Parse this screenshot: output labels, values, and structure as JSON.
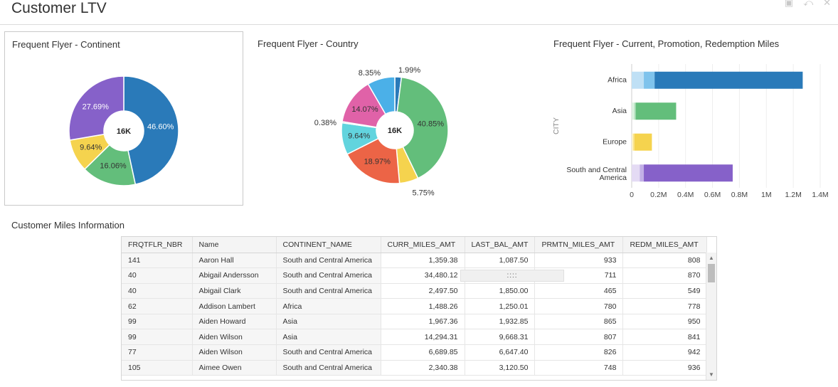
{
  "page": {
    "title": "Customer LTV"
  },
  "toolbar_icons": [
    "comment-icon",
    "share-icon",
    "close-icon"
  ],
  "continent_chart": {
    "title": "Frequent Flyer - Continent",
    "center_label": "16K",
    "slices": [
      {
        "label": "46.60%",
        "value": 46.6,
        "color": "#2a7ab9"
      },
      {
        "label": "16.06%",
        "value": 16.06,
        "color": "#63be7b"
      },
      {
        "label": "9.64%",
        "value": 9.64,
        "color": "#f5d34e"
      },
      {
        "label": "27.69%",
        "value": 27.69,
        "color": "#8661c9"
      }
    ]
  },
  "country_chart": {
    "title": "Frequent Flyer - Country",
    "center_label": "16K",
    "slices": [
      {
        "label": "1.99%",
        "value": 1.99,
        "color": "#2a7ab9"
      },
      {
        "label": "40.85%",
        "value": 40.85,
        "color": "#63be7b"
      },
      {
        "label": "5.75%",
        "value": 5.75,
        "color": "#f5d34e"
      },
      {
        "label": "18.97%",
        "value": 18.97,
        "color": "#ec6446"
      },
      {
        "label": "9.64%",
        "value": 9.64,
        "color": "#62d4de"
      },
      {
        "label": "0.38%",
        "value": 0.38,
        "color": "#2a6cb0"
      },
      {
        "label": "14.07%",
        "value": 14.07,
        "color": "#e062a8"
      },
      {
        "label": "8.35%",
        "value": 8.35,
        "color": "#4bb0e8"
      }
    ]
  },
  "miles_chart": {
    "title": "Frequent Flyer - Current, Promotion, Redemption Miles",
    "y_axis_label": "CITY",
    "x_ticks": [
      "0",
      "0.2M",
      "0.4M",
      "0.6M",
      "0.8M",
      "1M",
      "1.2M",
      "1.4M"
    ],
    "x_max": 1.4,
    "categories": [
      {
        "name": "Africa",
        "segments": [
          0.09,
          0.08,
          1.1
        ],
        "colors": [
          "#bfe0f5",
          "#7fc3ec",
          "#2a7ab9"
        ]
      },
      {
        "name": "Asia",
        "segments": [
          0.02,
          0.01,
          0.3
        ],
        "colors": [
          "#d9f1de",
          "#a7ddb4",
          "#63be7b"
        ]
      },
      {
        "name": "Europe",
        "segments": [
          0.01,
          0.01,
          0.13
        ],
        "colors": [
          "#fdf2c4",
          "#f9e38c",
          "#f5d34e"
        ]
      },
      {
        "name": "South and Central America",
        "segments": [
          0.06,
          0.03,
          0.66
        ],
        "colors": [
          "#e4dbf4",
          "#c2b0e6",
          "#8661c9"
        ]
      }
    ]
  },
  "table": {
    "title": "Customer Miles Information",
    "columns": [
      "FRQTFLR_NBR",
      "Name",
      "CONTINENT_NAME",
      "CURR_MILES_AMT",
      "LAST_BAL_AMT",
      "PRMTN_MILES_AMT",
      "REDM_MILES_AMT"
    ],
    "rows": [
      [
        "141",
        "Aaron Hall",
        "South and Central America",
        "1,359.38",
        "1,087.50",
        "933",
        "808"
      ],
      [
        "40",
        "Abigail Andersson",
        "South and Central America",
        "34,480.12",
        "",
        "711",
        "870"
      ],
      [
        "40",
        "Abigail Clark",
        "South and Central America",
        "2,497.50",
        "1,850.00",
        "465",
        "549"
      ],
      [
        "62",
        "Addison Lambert",
        "Africa",
        "1,488.26",
        "1,250.01",
        "780",
        "778"
      ],
      [
        "99",
        "Aiden Howard",
        "Asia",
        "1,967.36",
        "1,932.85",
        "865",
        "950"
      ],
      [
        "99",
        "Aiden Wilson",
        "Asia",
        "14,294.31",
        "9,668.31",
        "807",
        "841"
      ],
      [
        "77",
        "Aiden Wilson",
        "South and Central America",
        "6,689.85",
        "6,647.40",
        "826",
        "942"
      ],
      [
        "105",
        "Aimee Owen",
        "South and Central America",
        "2,340.38",
        "3,120.50",
        "748",
        "936"
      ]
    ],
    "cell_overlay": "::::"
  }
}
